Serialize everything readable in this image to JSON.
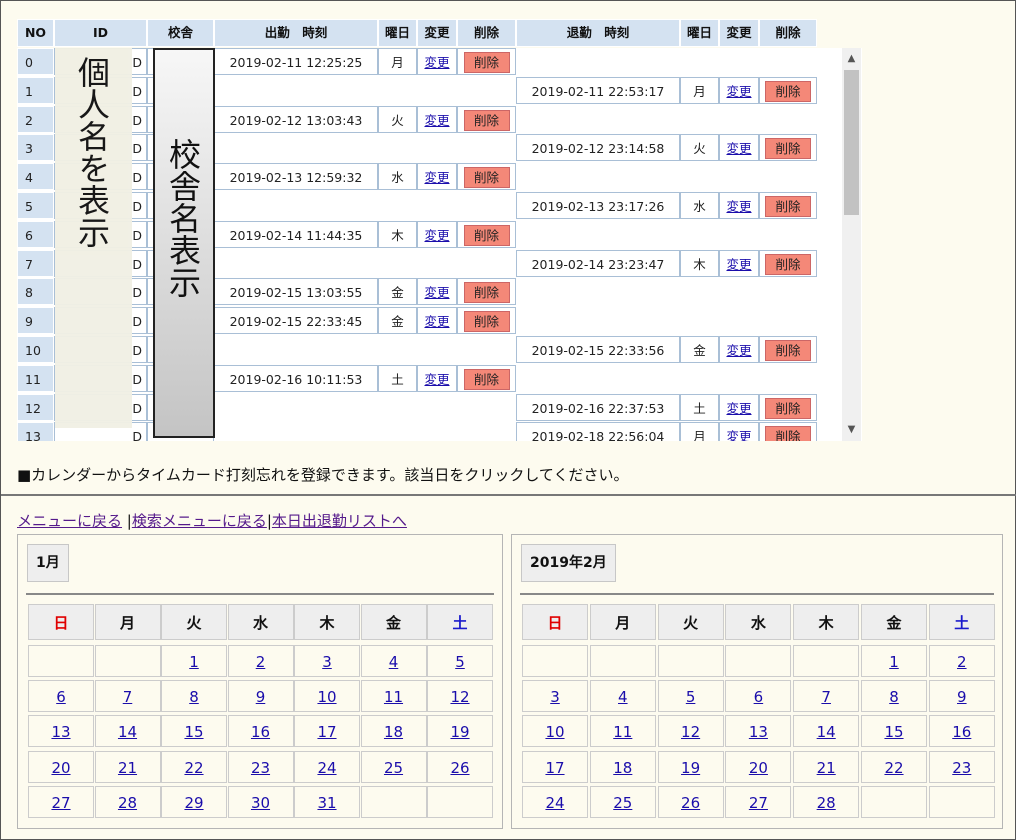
{
  "table": {
    "headers": [
      "NO",
      "ID",
      "校舎",
      "出勤　時刻",
      "曜日",
      "変更",
      "削除",
      "退勤　時刻",
      "曜日",
      "変更",
      "削除"
    ],
    "change_label": "変更",
    "delete_label": "削除",
    "id_suffix": "D",
    "rows": [
      {
        "no": "0",
        "in": "2019-02-11 12:25:25",
        "in_day": "月",
        "out": "",
        "out_day": ""
      },
      {
        "no": "1",
        "in": "",
        "in_day": "",
        "out": "2019-02-11 22:53:17",
        "out_day": "月"
      },
      {
        "no": "2",
        "in": "2019-02-12 13:03:43",
        "in_day": "火",
        "out": "",
        "out_day": ""
      },
      {
        "no": "3",
        "in": "",
        "in_day": "",
        "out": "2019-02-12 23:14:58",
        "out_day": "火"
      },
      {
        "no": "4",
        "in": "2019-02-13 12:59:32",
        "in_day": "水",
        "out": "",
        "out_day": ""
      },
      {
        "no": "5",
        "in": "",
        "in_day": "",
        "out": "2019-02-13 23:17:26",
        "out_day": "水"
      },
      {
        "no": "6",
        "in": "2019-02-14 11:44:35",
        "in_day": "木",
        "out": "",
        "out_day": ""
      },
      {
        "no": "7",
        "in": "",
        "in_day": "",
        "out": "2019-02-14 23:23:47",
        "out_day": "木"
      },
      {
        "no": "8",
        "in": "2019-02-15 13:03:55",
        "in_day": "金",
        "out": "",
        "out_day": ""
      },
      {
        "no": "9",
        "in": "2019-02-15 22:33:45",
        "in_day": "金",
        "out": "",
        "out_day": ""
      },
      {
        "no": "10",
        "in": "",
        "in_day": "",
        "out": "2019-02-15 22:33:56",
        "out_day": "金"
      },
      {
        "no": "11",
        "in": "2019-02-16 10:11:53",
        "in_day": "土",
        "out": "",
        "out_day": ""
      },
      {
        "no": "12",
        "in": "",
        "in_day": "",
        "out": "2019-02-16 22:37:53",
        "out_day": "土"
      },
      {
        "no": "13",
        "in": "",
        "in_day": "",
        "out": "2019-02-18 22:56:04",
        "out_day": "月"
      }
    ]
  },
  "overlays": {
    "name_text": "個人名を表示",
    "school_text": "校舎名表示"
  },
  "scroll": {
    "up_icon": "▲",
    "down_icon": "▼"
  },
  "notice": "■カレンダーからタイムカード打刻忘れを登録できます。該当日をクリックしてください。",
  "nav": {
    "menu": "メニューに戻る",
    "sep1": " |",
    "search_menu": "検索メニューに戻る",
    "sep2": "|",
    "today_list": "本日出退勤リストへ"
  },
  "weekdays": [
    "日",
    "月",
    "火",
    "水",
    "木",
    "金",
    "土"
  ],
  "calendars": [
    {
      "title": "1月",
      "weeks": [
        [
          "",
          "",
          "1",
          "2",
          "3",
          "4",
          "5"
        ],
        [
          "6",
          "7",
          "8",
          "9",
          "10",
          "11",
          "12"
        ],
        [
          "13",
          "14",
          "15",
          "16",
          "17",
          "18",
          "19"
        ],
        [
          "20",
          "21",
          "22",
          "23",
          "24",
          "25",
          "26"
        ],
        [
          "27",
          "28",
          "29",
          "30",
          "31",
          "",
          ""
        ]
      ]
    },
    {
      "title": "2019年2月",
      "weeks": [
        [
          "",
          "",
          "",
          "",
          "",
          "1",
          "2"
        ],
        [
          "3",
          "4",
          "5",
          "6",
          "7",
          "8",
          "9"
        ],
        [
          "10",
          "11",
          "12",
          "13",
          "14",
          "15",
          "16"
        ],
        [
          "17",
          "18",
          "19",
          "20",
          "21",
          "22",
          "23"
        ],
        [
          "24",
          "25",
          "26",
          "27",
          "28",
          "",
          ""
        ]
      ]
    }
  ]
}
